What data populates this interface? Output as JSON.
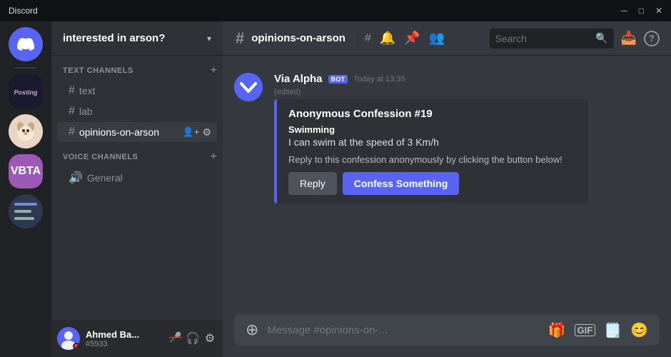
{
  "titlebar": {
    "title": "Discord",
    "minimize": "─",
    "maximize": "□",
    "close": "✕"
  },
  "server_list": {
    "home_icon": "🎮",
    "servers": [
      {
        "id": "posting",
        "label": "Posting",
        "type": "image"
      },
      {
        "id": "dog",
        "label": "Dog",
        "type": "image"
      },
      {
        "id": "vbta",
        "label": "VBTA",
        "type": "text"
      },
      {
        "id": "bottom",
        "label": "",
        "type": "image"
      }
    ]
  },
  "channel_sidebar": {
    "server_name": "interested in arson?",
    "text_channels_label": "TEXT CHANNELS",
    "voice_channels_label": "VOICE CHANNELS",
    "channels": [
      {
        "name": "text",
        "type": "text"
      },
      {
        "name": "lab",
        "type": "text"
      },
      {
        "name": "opinions-on-arson",
        "type": "text",
        "active": true
      }
    ],
    "voice_channels": [
      {
        "name": "General",
        "type": "voice"
      }
    ],
    "user": {
      "name": "Ahmed Ba...",
      "discriminator": "#5933",
      "status": "muted"
    }
  },
  "topbar": {
    "channel_hash": "#",
    "channel_name": "opinions-on-arson",
    "icons": [
      "#",
      "#",
      "🔔",
      "📌",
      "👤"
    ],
    "search_placeholder": "Search",
    "search_value": ""
  },
  "message": {
    "author": "Via Alpha",
    "bot_badge": "BOT",
    "timestamp": "Today at 13:35",
    "edited": "(edited)",
    "embed": {
      "title": "Anonymous Confession #19",
      "field_name": "Swimming",
      "field_value": "I can swim at the speed of 3 Km/h",
      "description": "Reply to this confession anonymously by clicking the button below!",
      "reply_button": "Reply",
      "confess_button": "Confess Something"
    }
  },
  "input": {
    "placeholder": "Message #opinions-on-..."
  }
}
